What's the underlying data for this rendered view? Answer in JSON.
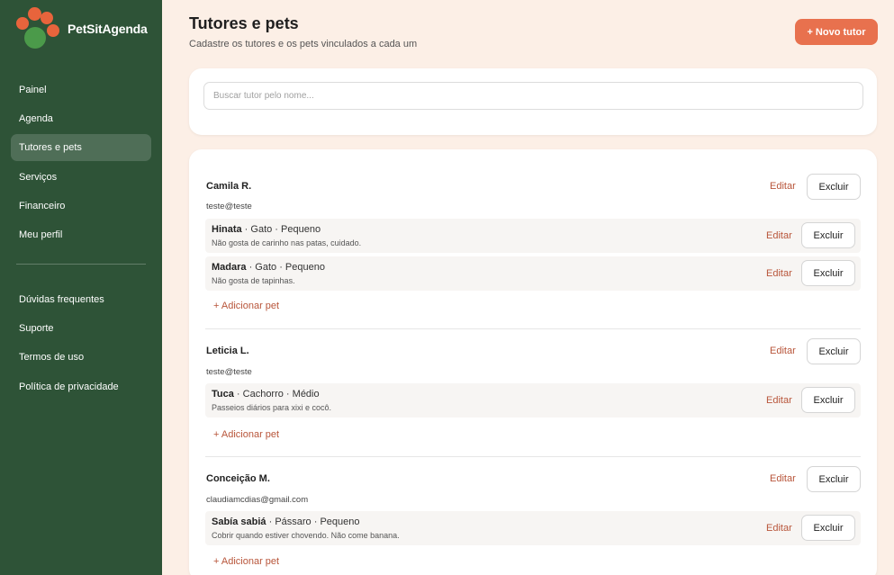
{
  "app": {
    "name": "PetSitAgenda"
  },
  "sidebar": {
    "items": [
      {
        "label": "Painel"
      },
      {
        "label": "Agenda"
      },
      {
        "label": "Tutores e pets"
      },
      {
        "label": "Serviços"
      },
      {
        "label": "Financeiro"
      },
      {
        "label": "Meu perfil"
      }
    ],
    "secondary": [
      {
        "label": "Dúvidas frequentes"
      },
      {
        "label": "Suporte"
      },
      {
        "label": "Termos de uso"
      },
      {
        "label": "Política de privacidade"
      }
    ]
  },
  "header": {
    "title": "Tutores e pets",
    "subtitle": "Cadastre os tutores e os pets vinculados a cada um",
    "new_button": "+ Novo tutor"
  },
  "search": {
    "placeholder": "Buscar tutor pelo nome..."
  },
  "actions": {
    "edit": "Editar",
    "delete": "Excluir",
    "add_pet": "+ Adicionar pet"
  },
  "tutors": [
    {
      "name": "Camila R.",
      "email": "teste@teste",
      "pets": [
        {
          "name": "Hinata",
          "details": " · Gato · Pequeno",
          "note": "Não gosta de carinho nas patas, cuidado."
        },
        {
          "name": "Madara",
          "details": " · Gato · Pequeno",
          "note": "Não gosta de tapinhas."
        }
      ]
    },
    {
      "name": "Leticia L.",
      "email": "teste@teste",
      "pets": [
        {
          "name": "Tuca",
          "details": " · Cachorro · Médio",
          "note": "Passeios diários para xixi e cocô."
        }
      ]
    },
    {
      "name": "Conceição M.",
      "email": "claudiamcdias@gmail.com",
      "pets": [
        {
          "name": "Sabía sabiá",
          "details": " · Pássaro · Pequeno",
          "note": "Cobrir quando estiver chovendo. Não come banana."
        }
      ]
    }
  ],
  "colors": {
    "sidebar": "#2e5337",
    "accent": "#e8714e",
    "link": "#b8553a",
    "background": "#fcefe6"
  }
}
